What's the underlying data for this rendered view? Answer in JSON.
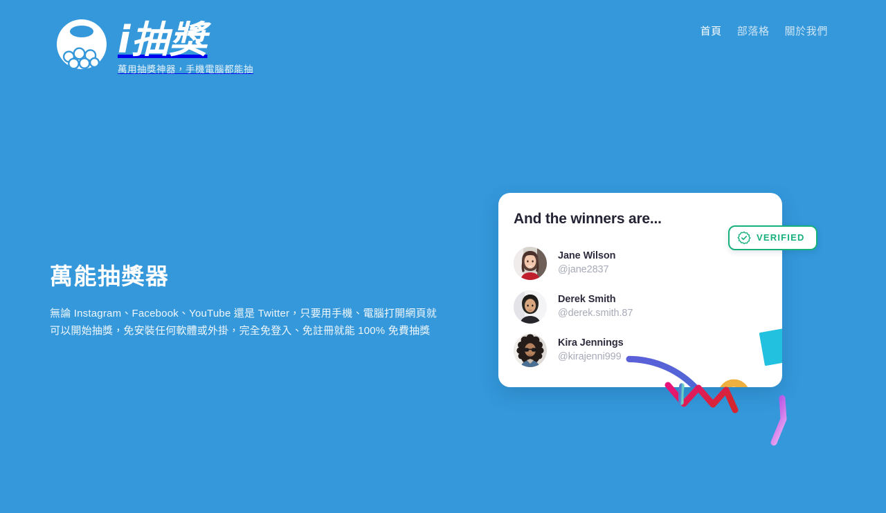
{
  "page": {
    "background_color": "#3498db",
    "lang": "zh-TW"
  },
  "header": {
    "brand": {
      "logo_icon": "lottery-ball-machine-icon",
      "title": "i抽獎",
      "tagline": "萬用抽獎神器，手機電腦都能抽"
    },
    "nav": {
      "items": [
        {
          "label": "首頁",
          "active": true
        },
        {
          "label": "部落格",
          "active": false
        },
        {
          "label": "關於我們",
          "active": false
        }
      ]
    }
  },
  "hero": {
    "title": "萬能抽獎器",
    "description": "無論 Instagram、Facebook、YouTube 還是 Twitter，只要用手機、電腦打開網頁就可以開始抽獎，免安裝任何軟體或外掛，完全免登入、免註冊就能 100% 免費抽獎"
  },
  "winners_card": {
    "title": "And the winners are...",
    "verified": {
      "label": "VERIFIED",
      "icon": "verified-seal-check-icon",
      "color": "#16b07a"
    },
    "winners": [
      {
        "name": "Jane Wilson",
        "handle": "@jane2837",
        "avatar_icon": "avatar-jane-wilson"
      },
      {
        "name": "Derek Smith",
        "handle": "@derek.smith.87",
        "avatar_icon": "avatar-derek-smith"
      },
      {
        "name": "Kira Jennings",
        "handle": "@kirajenni999",
        "avatar_icon": "avatar-kira-jennings"
      }
    ]
  },
  "decorations": {
    "shapes": [
      {
        "name": "cyan-square",
        "color": "#22c1e0"
      },
      {
        "name": "purple-zigzag",
        "color_start": "#7c3aed",
        "color_end": "#e29bf0"
      },
      {
        "name": "blue-teal-arc",
        "color_start": "#5b5fd8",
        "color_end": "#5ec9c0"
      },
      {
        "name": "orange-ring",
        "color": "#f0b040"
      },
      {
        "name": "green-ring",
        "color": "#0fa86a"
      },
      {
        "name": "purple-triangle",
        "color": "#b794e8"
      },
      {
        "name": "pink-red-zigzag",
        "color_start": "#e8147c",
        "color_end": "#d42630"
      }
    ]
  }
}
